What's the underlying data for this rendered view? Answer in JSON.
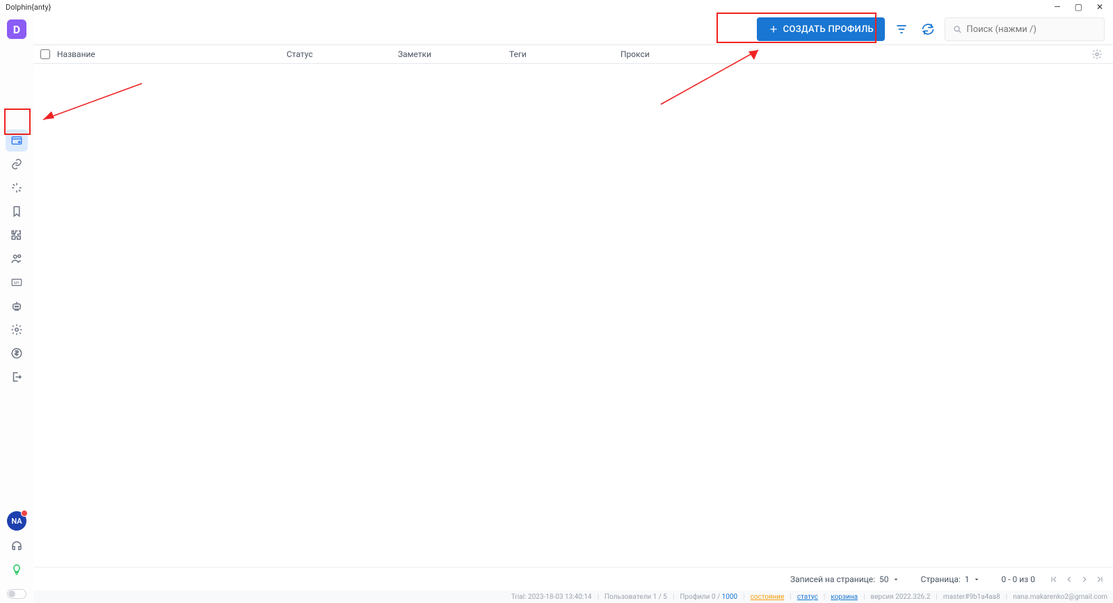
{
  "window": {
    "title": "Dolphin{anty}"
  },
  "sidebar": {
    "logo_letter": "D",
    "avatar_initials": "NA"
  },
  "toolbar": {
    "create_label": "СОЗДАТЬ ПРОФИЛЬ",
    "search_placeholder": "Поиск (нажми /)"
  },
  "table": {
    "columns": {
      "name": "Название",
      "status": "Статус",
      "notes": "Заметки",
      "tags": "Теги",
      "proxy": "Прокси"
    }
  },
  "pagination": {
    "per_page_label": "Записей на странице:",
    "per_page_value": "50",
    "page_label": "Страница:",
    "page_value": "1",
    "range_text": "0 - 0 из 0"
  },
  "footer": {
    "trial": "Trial: 2023-18-03 13:40:14",
    "users": "Пользователи 1 / 5",
    "profiles_a": "Профили 0 /",
    "profiles_b": "1000",
    "link_status1": "состояние",
    "link_status2": "статус",
    "link_trash": "корзина",
    "version": "версия 2022.326.2",
    "master": "master#9b1a4aa8",
    "email": "nana.makarenko2@gmail.com"
  }
}
